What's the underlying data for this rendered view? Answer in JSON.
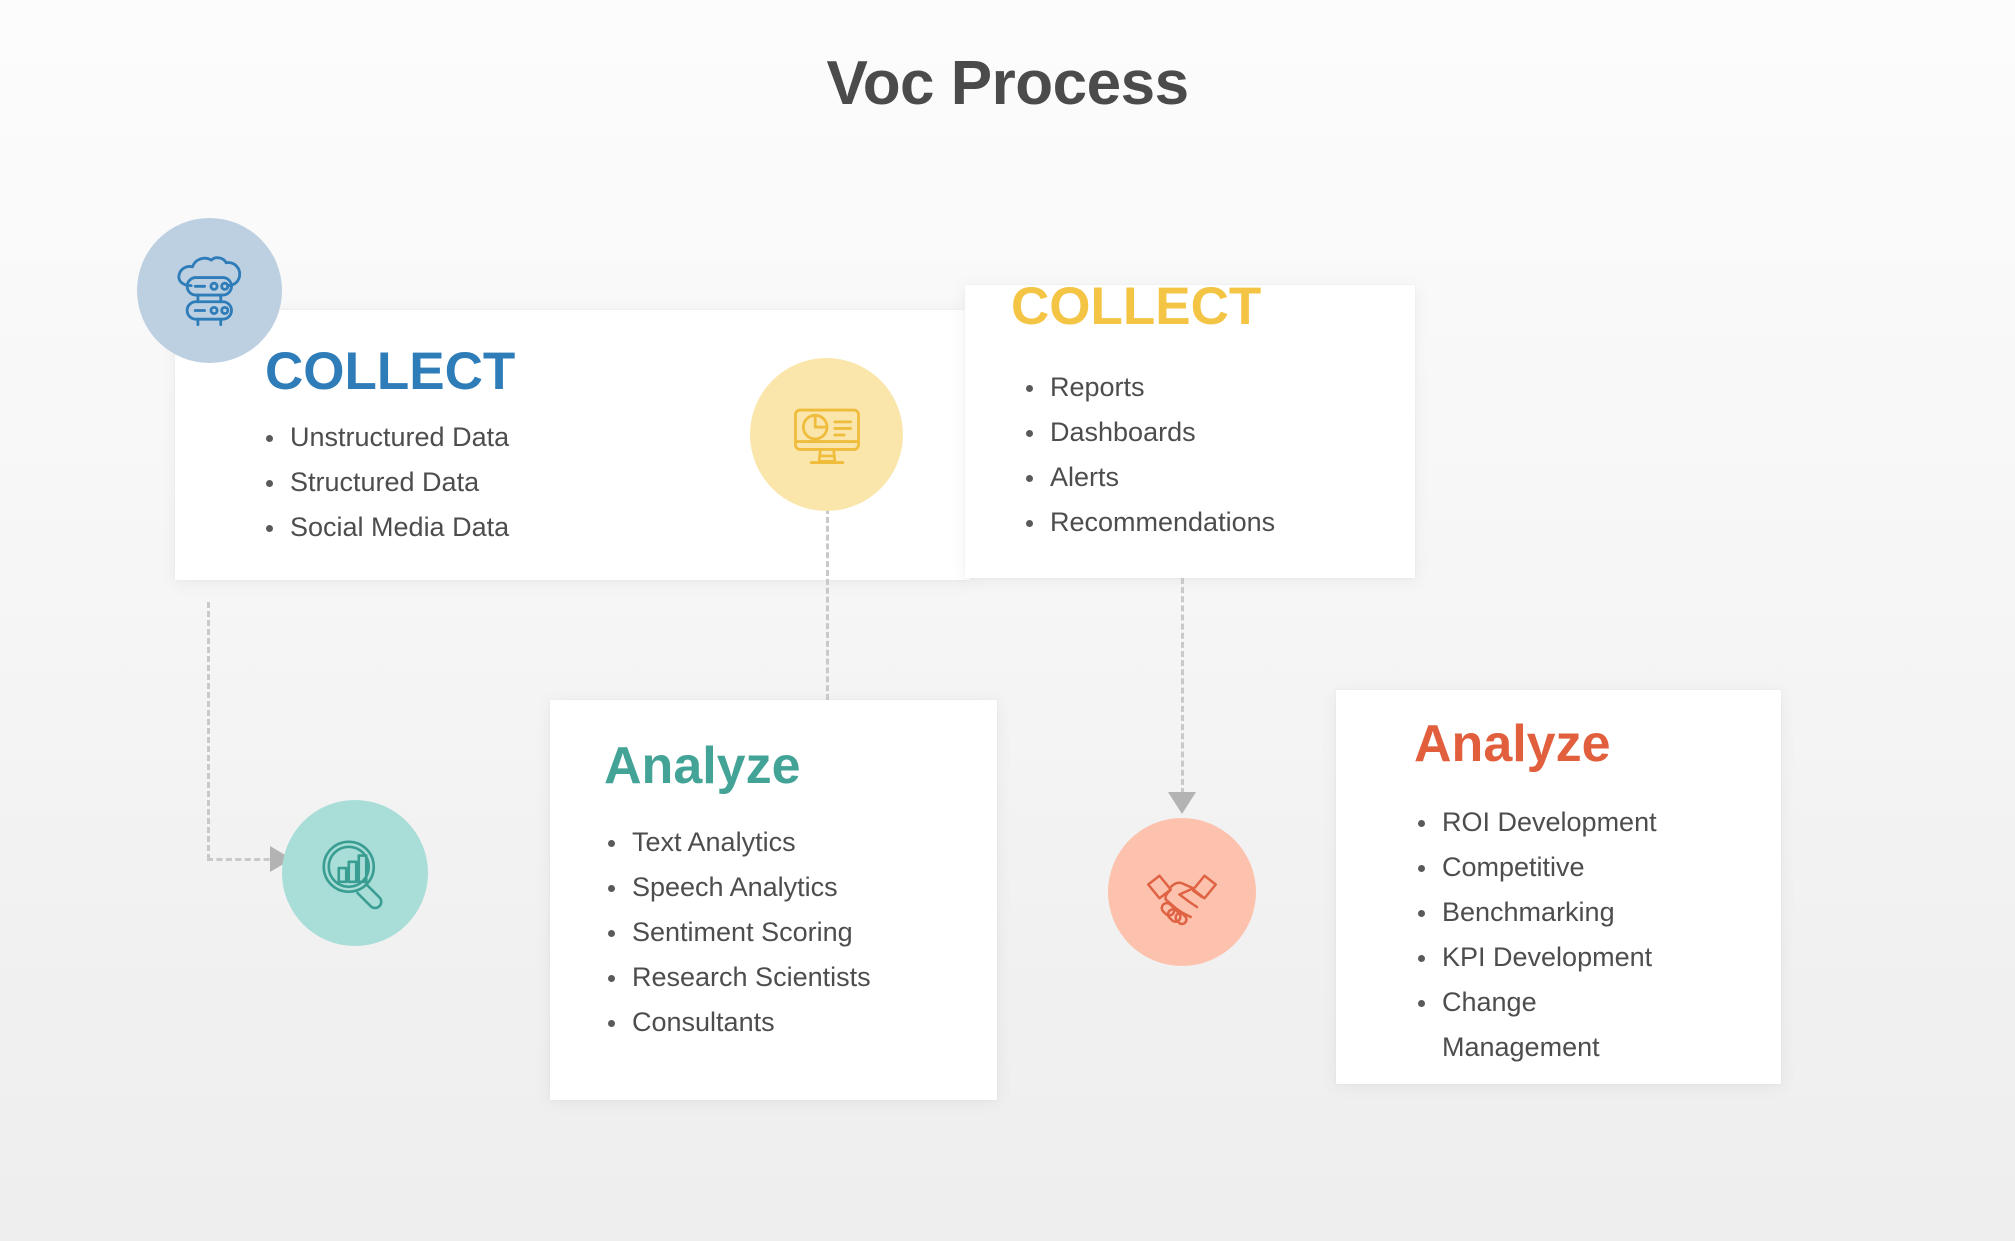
{
  "title": "Voc Process",
  "colors": {
    "blue": "#2e7cb8",
    "blue_circle": "#bdd0e2",
    "yellow": "#f4c445",
    "yellow_circle": "#fae5ab",
    "teal": "#42a396",
    "teal_circle": "#a8ddd8",
    "orange": "#e15f3d",
    "orange_circle": "#fcc2ae",
    "connector": "#c9c9c9",
    "text": "#4d4d4d",
    "title_color": "#4b4b4b"
  },
  "nodes": {
    "collect_blue": {
      "heading": "COLLECT",
      "icon": "cloud-database-icon",
      "bullets": [
        "Unstructured Data",
        "Structured Data",
        "Social Media Data"
      ]
    },
    "collect_yellow": {
      "heading": "COLLECT",
      "icon": "dashboard-monitor-icon",
      "bullets": [
        "Reports",
        "Dashboards",
        "Alerts",
        "Recommendations"
      ]
    },
    "analyze_teal": {
      "heading": "Analyze",
      "icon": "magnifier-chart-icon",
      "bullets": [
        "Text Analytics",
        "Speech Analytics",
        "Sentiment Scoring",
        "Research Scientists",
        "Consultants"
      ]
    },
    "analyze_orange": {
      "heading": "Analyze",
      "icon": "handshake-icon",
      "bullets": [
        "ROI Development",
        "Competitive",
        "Benchmarking",
        "KPI Development",
        "Change Management"
      ]
    }
  },
  "connectors": [
    {
      "name": "collect-blue-to-analyze-teal",
      "style": "dashed",
      "arrow": "right"
    },
    {
      "name": "analyze-teal-to-collect-yellow",
      "style": "dashed",
      "arrow": "up"
    },
    {
      "name": "collect-yellow-to-analyze-orange",
      "style": "dashed",
      "arrow": "down"
    }
  ]
}
